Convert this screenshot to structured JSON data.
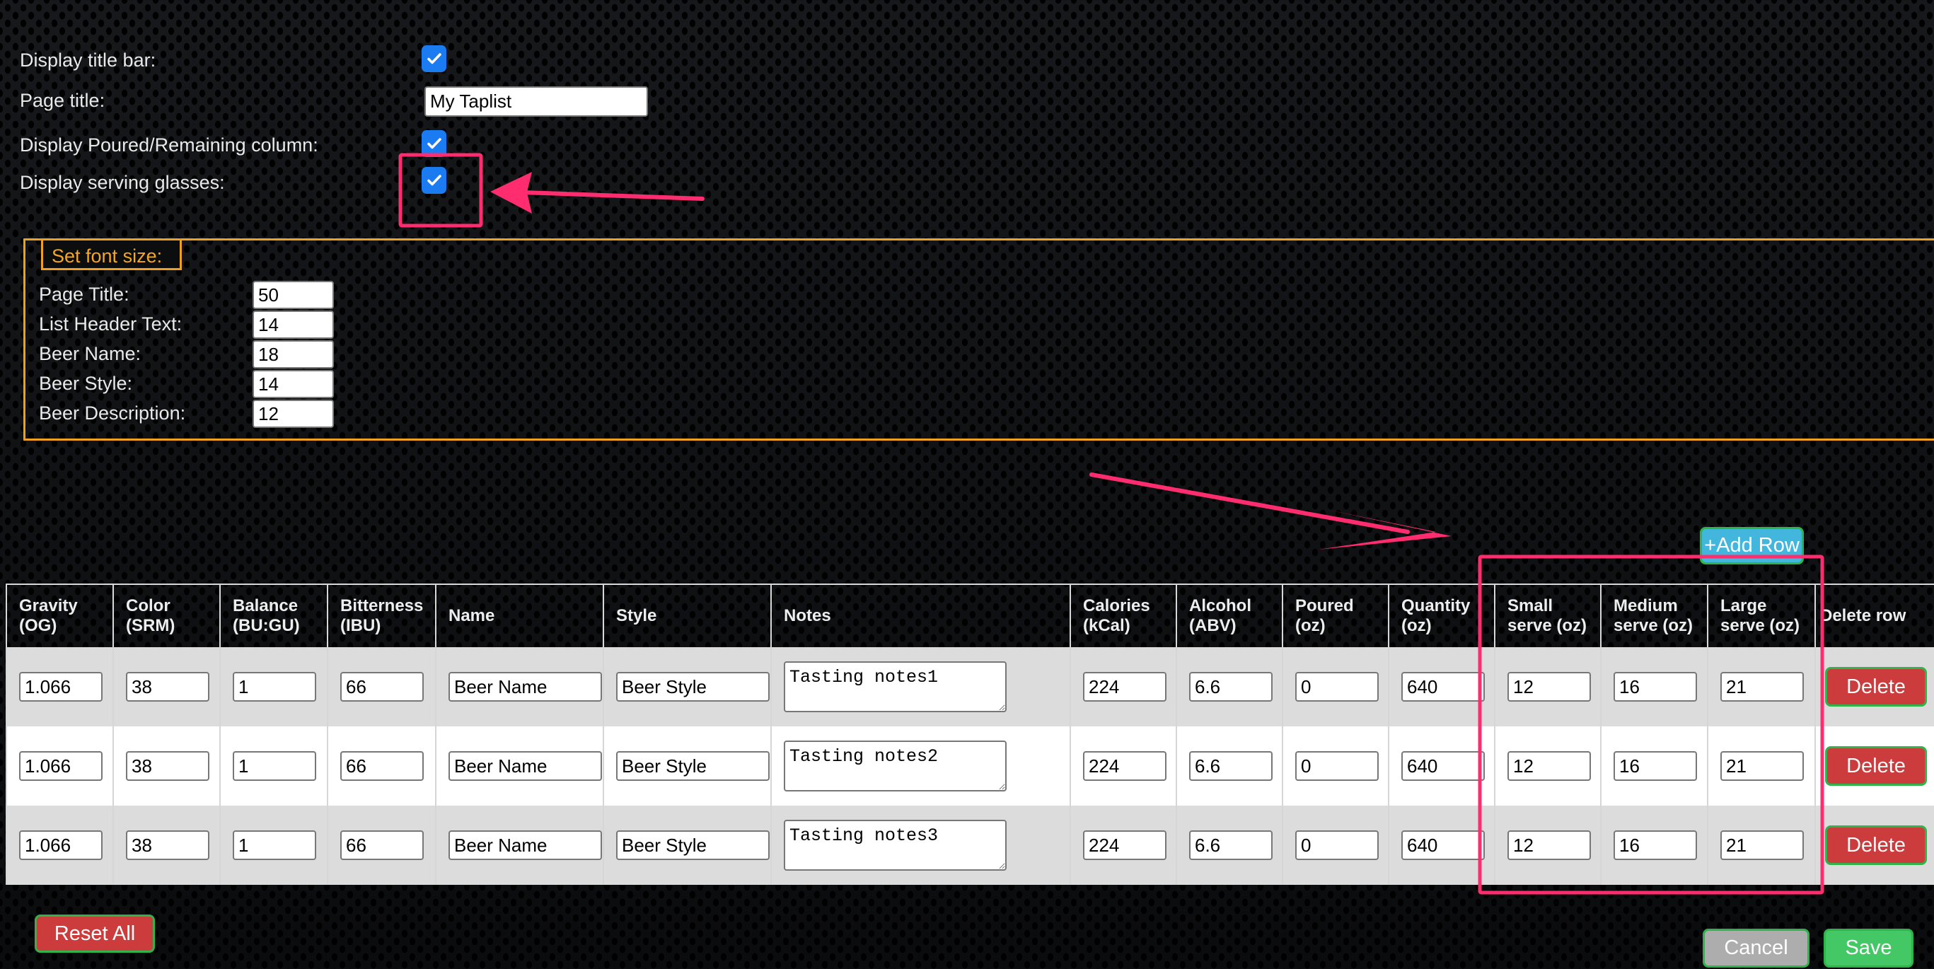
{
  "settings": {
    "display_title_bar": {
      "label": "Display title bar:",
      "checked": true
    },
    "page_title": {
      "label": "Page title:",
      "value": "My Taplist"
    },
    "display_poured_remaining": {
      "label": "Display Poured/Remaining column:",
      "checked": true
    },
    "display_serving_glasses": {
      "label": "Display serving glasses:",
      "checked": true
    }
  },
  "font_size": {
    "legend": "Set font size:",
    "fields": [
      {
        "label": "Page Title:",
        "value": "50"
      },
      {
        "label": "List Header Text:",
        "value": "14"
      },
      {
        "label": "Beer Name:",
        "value": "18"
      },
      {
        "label": "Beer Style:",
        "value": "14"
      },
      {
        "label": "Beer Description:",
        "value": "12"
      }
    ]
  },
  "buttons": {
    "add_row": "+Add Row",
    "reset_all": "Reset All",
    "cancel": "Cancel",
    "save": "Save",
    "delete": "Delete"
  },
  "table": {
    "headers": [
      [
        "Gravity",
        "(OG)"
      ],
      [
        "Color",
        "(SRM)"
      ],
      [
        "Balance",
        "(BU:GU)"
      ],
      [
        "Bitterness",
        "(IBU)"
      ],
      [
        "Name",
        ""
      ],
      [
        "Style",
        ""
      ],
      [
        "Notes",
        ""
      ],
      [
        "Calories",
        "(kCal)"
      ],
      [
        "Alcohol",
        "(ABV)"
      ],
      [
        "Poured",
        "(oz)"
      ],
      [
        "Quantity",
        "(oz)"
      ],
      [
        "Small",
        "serve (oz)"
      ],
      [
        "Medium",
        "serve (oz)"
      ],
      [
        "Large",
        "serve (oz)"
      ],
      [
        "Delete row",
        ""
      ]
    ],
    "rows": [
      {
        "gravity": "1.066",
        "color": "38",
        "balance": "1",
        "bitterness": "66",
        "name": "Beer Name",
        "style": "Beer Style",
        "notes": "Tasting notes1",
        "calories": "224",
        "alcohol": "6.6",
        "poured": "0",
        "quantity": "640",
        "small": "12",
        "medium": "16",
        "large": "21"
      },
      {
        "gravity": "1.066",
        "color": "38",
        "balance": "1",
        "bitterness": "66",
        "name": "Beer Name",
        "style": "Beer Style",
        "notes": "Tasting notes2",
        "calories": "224",
        "alcohol": "6.6",
        "poured": "0",
        "quantity": "640",
        "small": "12",
        "medium": "16",
        "large": "21"
      },
      {
        "gravity": "1.066",
        "color": "38",
        "balance": "1",
        "bitterness": "66",
        "name": "Beer Name",
        "style": "Beer Style",
        "notes": "Tasting notes3",
        "calories": "224",
        "alcohol": "6.6",
        "poured": "0",
        "quantity": "640",
        "small": "12",
        "medium": "16",
        "large": "21"
      }
    ]
  },
  "colors": {
    "checkbox": "#1a7cf0",
    "fieldset_border": "#f0a020",
    "annotation": "#ff2d6f",
    "delete": "#cc3c3c",
    "add_row": "#43b6dd",
    "save": "#44c866",
    "cancel": "#adadad"
  }
}
